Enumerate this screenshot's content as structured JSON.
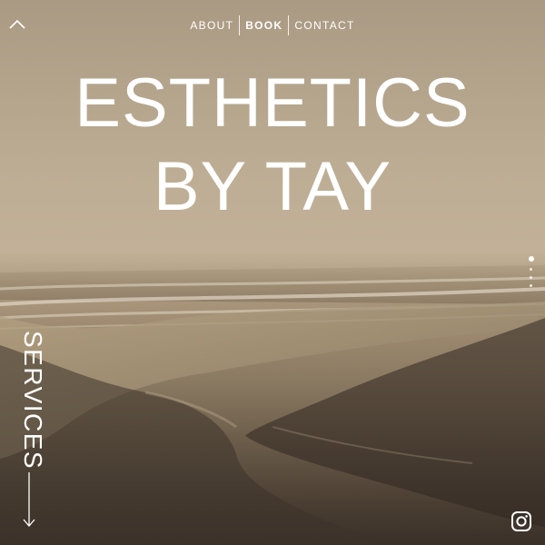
{
  "nav": {
    "items": [
      {
        "label": "ABOUT",
        "bold": false
      },
      {
        "label": "BOOK",
        "bold": true
      },
      {
        "label": "CONTACT",
        "bold": false
      }
    ]
  },
  "hero": {
    "title_line1": "ESTHETICS",
    "title_line2": "BY TAY"
  },
  "side": {
    "services_label": "SERVICES"
  },
  "icons": {
    "top_left": "chevron-up-icon",
    "bottom_right": "instagram-icon",
    "scroll": "arrow-down-icon"
  },
  "colors": {
    "text": "#ffffff",
    "sky": "#bdad94",
    "sand_dark": "#3a3028"
  }
}
